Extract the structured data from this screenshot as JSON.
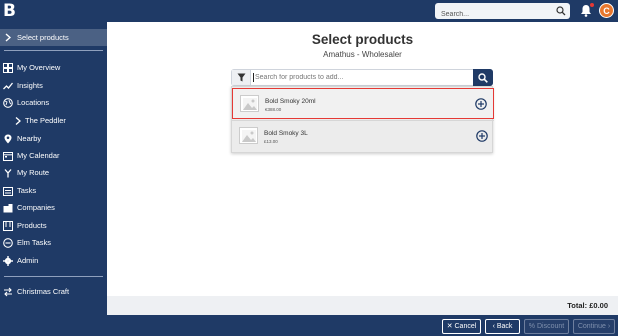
{
  "app": {
    "logo": "B"
  },
  "topbar": {
    "search_placeholder": "Search...",
    "avatar_initial": "C"
  },
  "sidebar": {
    "active": {
      "label": "Select products"
    },
    "items": [
      {
        "label": "My Overview",
        "icon": "overview-icon"
      },
      {
        "label": "Insights",
        "icon": "insights-icon"
      },
      {
        "label": "Locations",
        "icon": "locations-icon"
      },
      {
        "label": "The Peddler",
        "icon": "chevron-right-icon"
      },
      {
        "label": "Nearby",
        "icon": "pin-icon"
      },
      {
        "label": "My Calendar",
        "icon": "calendar-icon"
      },
      {
        "label": "My Route",
        "icon": "route-icon"
      },
      {
        "label": "Tasks",
        "icon": "tasks-icon"
      },
      {
        "label": "Companies",
        "icon": "companies-icon"
      },
      {
        "label": "Products",
        "icon": "products-icon"
      },
      {
        "label": "Elm Tasks",
        "icon": "elm-tasks-icon"
      },
      {
        "label": "Admin",
        "icon": "gear-icon"
      }
    ],
    "switch_account": {
      "label": "Christmas Craft",
      "icon": "switch-icon"
    }
  },
  "main": {
    "title": "Select products",
    "subtitle": "Amathus - Wholesaler",
    "search_placeholder": "Search for products to add...",
    "products": [
      {
        "name": "Bold Smoky 20ml",
        "price": "€388.00",
        "selected": true
      },
      {
        "name": "Bold Smoky 3L",
        "price": "£13.00",
        "selected": false
      }
    ],
    "total": "Total: £0.00"
  },
  "actions": {
    "cancel": "Cancel",
    "back": "Back",
    "discount": "Discount",
    "continue": "Continue"
  },
  "colors": {
    "navy": "#1f3a66",
    "highlight": "#e53935",
    "avatar": "#e8772e"
  }
}
